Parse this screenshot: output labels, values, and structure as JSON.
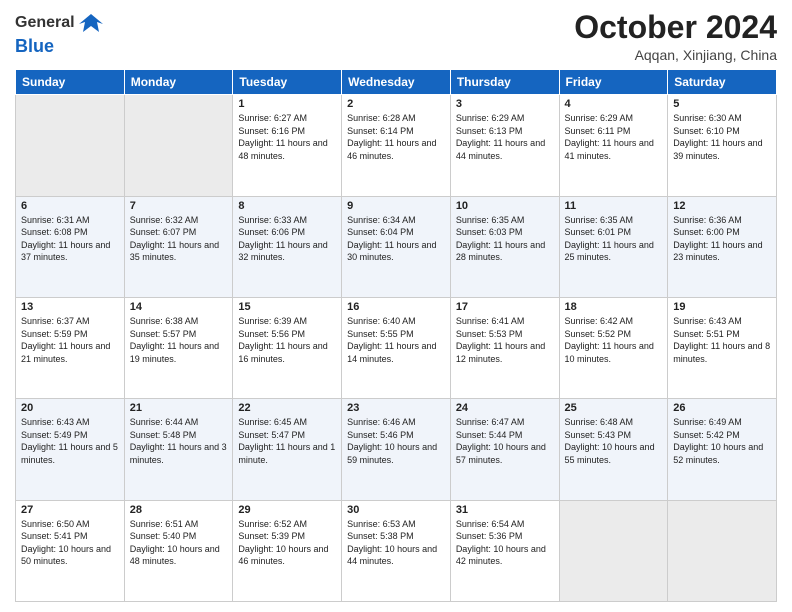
{
  "header": {
    "logo_general": "General",
    "logo_blue": "Blue",
    "month_title": "October 2024",
    "location": "Aqqan, Xinjiang, China"
  },
  "calendar": {
    "days_of_week": [
      "Sunday",
      "Monday",
      "Tuesday",
      "Wednesday",
      "Thursday",
      "Friday",
      "Saturday"
    ],
    "weeks": [
      [
        {
          "day": "",
          "info": ""
        },
        {
          "day": "",
          "info": ""
        },
        {
          "day": "1",
          "info": "Sunrise: 6:27 AM\nSunset: 6:16 PM\nDaylight: 11 hours and 48 minutes."
        },
        {
          "day": "2",
          "info": "Sunrise: 6:28 AM\nSunset: 6:14 PM\nDaylight: 11 hours and 46 minutes."
        },
        {
          "day": "3",
          "info": "Sunrise: 6:29 AM\nSunset: 6:13 PM\nDaylight: 11 hours and 44 minutes."
        },
        {
          "day": "4",
          "info": "Sunrise: 6:29 AM\nSunset: 6:11 PM\nDaylight: 11 hours and 41 minutes."
        },
        {
          "day": "5",
          "info": "Sunrise: 6:30 AM\nSunset: 6:10 PM\nDaylight: 11 hours and 39 minutes."
        }
      ],
      [
        {
          "day": "6",
          "info": "Sunrise: 6:31 AM\nSunset: 6:08 PM\nDaylight: 11 hours and 37 minutes."
        },
        {
          "day": "7",
          "info": "Sunrise: 6:32 AM\nSunset: 6:07 PM\nDaylight: 11 hours and 35 minutes."
        },
        {
          "day": "8",
          "info": "Sunrise: 6:33 AM\nSunset: 6:06 PM\nDaylight: 11 hours and 32 minutes."
        },
        {
          "day": "9",
          "info": "Sunrise: 6:34 AM\nSunset: 6:04 PM\nDaylight: 11 hours and 30 minutes."
        },
        {
          "day": "10",
          "info": "Sunrise: 6:35 AM\nSunset: 6:03 PM\nDaylight: 11 hours and 28 minutes."
        },
        {
          "day": "11",
          "info": "Sunrise: 6:35 AM\nSunset: 6:01 PM\nDaylight: 11 hours and 25 minutes."
        },
        {
          "day": "12",
          "info": "Sunrise: 6:36 AM\nSunset: 6:00 PM\nDaylight: 11 hours and 23 minutes."
        }
      ],
      [
        {
          "day": "13",
          "info": "Sunrise: 6:37 AM\nSunset: 5:59 PM\nDaylight: 11 hours and 21 minutes."
        },
        {
          "day": "14",
          "info": "Sunrise: 6:38 AM\nSunset: 5:57 PM\nDaylight: 11 hours and 19 minutes."
        },
        {
          "day": "15",
          "info": "Sunrise: 6:39 AM\nSunset: 5:56 PM\nDaylight: 11 hours and 16 minutes."
        },
        {
          "day": "16",
          "info": "Sunrise: 6:40 AM\nSunset: 5:55 PM\nDaylight: 11 hours and 14 minutes."
        },
        {
          "day": "17",
          "info": "Sunrise: 6:41 AM\nSunset: 5:53 PM\nDaylight: 11 hours and 12 minutes."
        },
        {
          "day": "18",
          "info": "Sunrise: 6:42 AM\nSunset: 5:52 PM\nDaylight: 11 hours and 10 minutes."
        },
        {
          "day": "19",
          "info": "Sunrise: 6:43 AM\nSunset: 5:51 PM\nDaylight: 11 hours and 8 minutes."
        }
      ],
      [
        {
          "day": "20",
          "info": "Sunrise: 6:43 AM\nSunset: 5:49 PM\nDaylight: 11 hours and 5 minutes."
        },
        {
          "day": "21",
          "info": "Sunrise: 6:44 AM\nSunset: 5:48 PM\nDaylight: 11 hours and 3 minutes."
        },
        {
          "day": "22",
          "info": "Sunrise: 6:45 AM\nSunset: 5:47 PM\nDaylight: 11 hours and 1 minute."
        },
        {
          "day": "23",
          "info": "Sunrise: 6:46 AM\nSunset: 5:46 PM\nDaylight: 10 hours and 59 minutes."
        },
        {
          "day": "24",
          "info": "Sunrise: 6:47 AM\nSunset: 5:44 PM\nDaylight: 10 hours and 57 minutes."
        },
        {
          "day": "25",
          "info": "Sunrise: 6:48 AM\nSunset: 5:43 PM\nDaylight: 10 hours and 55 minutes."
        },
        {
          "day": "26",
          "info": "Sunrise: 6:49 AM\nSunset: 5:42 PM\nDaylight: 10 hours and 52 minutes."
        }
      ],
      [
        {
          "day": "27",
          "info": "Sunrise: 6:50 AM\nSunset: 5:41 PM\nDaylight: 10 hours and 50 minutes."
        },
        {
          "day": "28",
          "info": "Sunrise: 6:51 AM\nSunset: 5:40 PM\nDaylight: 10 hours and 48 minutes."
        },
        {
          "day": "29",
          "info": "Sunrise: 6:52 AM\nSunset: 5:39 PM\nDaylight: 10 hours and 46 minutes."
        },
        {
          "day": "30",
          "info": "Sunrise: 6:53 AM\nSunset: 5:38 PM\nDaylight: 10 hours and 44 minutes."
        },
        {
          "day": "31",
          "info": "Sunrise: 6:54 AM\nSunset: 5:36 PM\nDaylight: 10 hours and 42 minutes."
        },
        {
          "day": "",
          "info": ""
        },
        {
          "day": "",
          "info": ""
        }
      ]
    ]
  }
}
